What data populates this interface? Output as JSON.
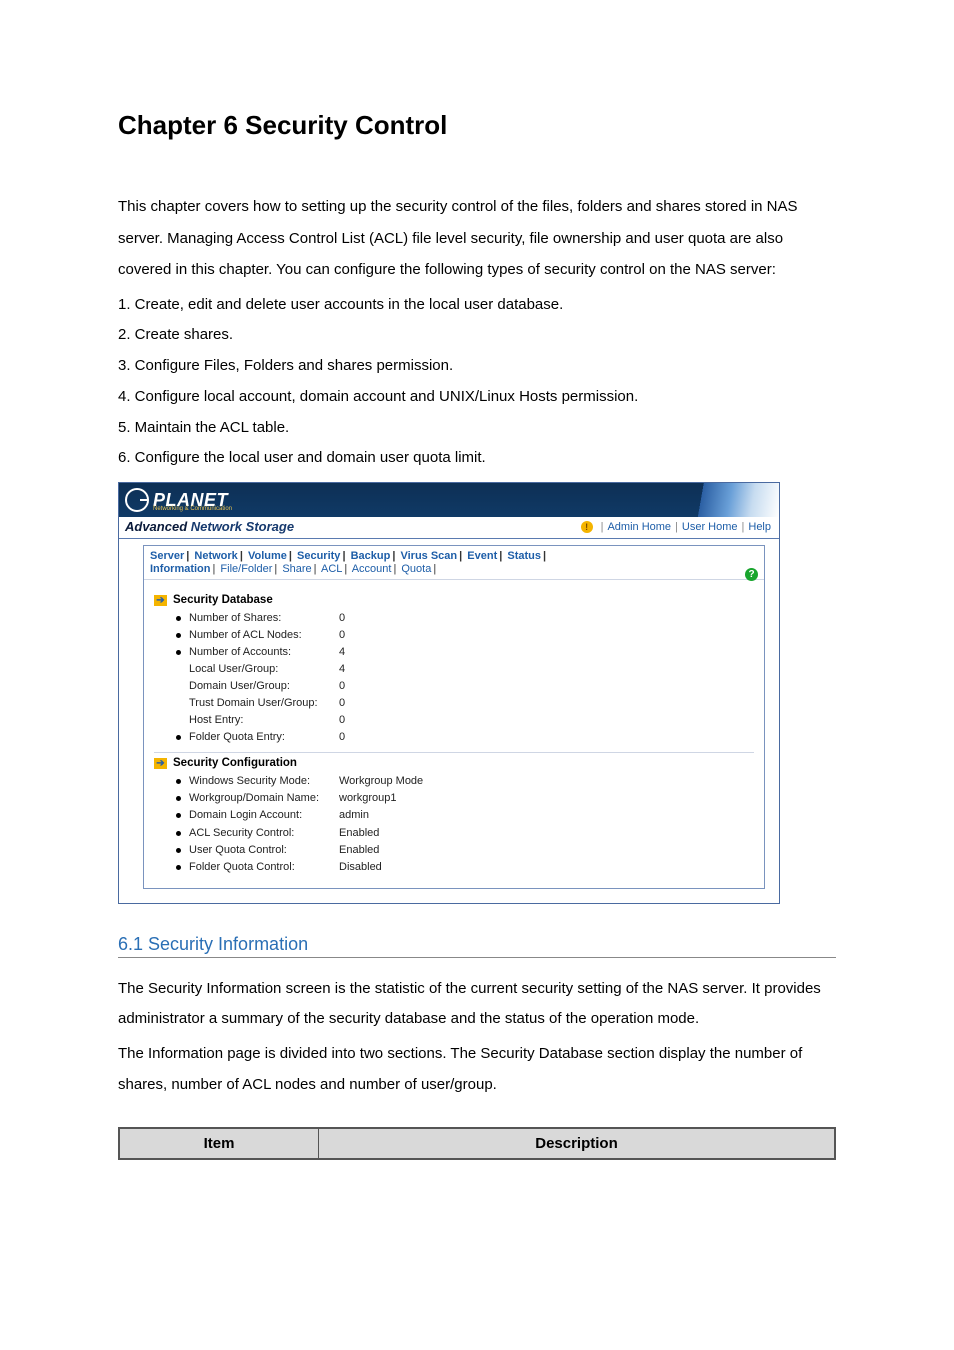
{
  "chapter_title": "Chapter 6 Security Control",
  "intro_paragraph": "This chapter covers how to setting up the security control of the files, folders and shares stored in NAS server. Managing Access Control List (ACL) file level security, file ownership and user quota are also covered in this chapter. You can configure the following types of security control on the NAS server:",
  "intro_items": [
    "1. Create, edit and delete user accounts in the local user database.",
    "2. Create shares.",
    "3. Configure Files, Folders and shares permission.",
    "4. Configure local account, domain account and UNIX/Linux Hosts permission.",
    "5. Maintain the ACL table.",
    "6. Configure the local user and domain user quota limit."
  ],
  "app": {
    "brand_text": "PLANET",
    "brand_sub": "Networking & Communication",
    "product_title_a": "Advanced ",
    "product_title_b": "Network Storage",
    "header_links": {
      "admin_home": "Admin Home",
      "user_home": "User Home",
      "help": "Help"
    },
    "main_tabs": [
      "Server",
      "Network",
      "Volume",
      "Security",
      "Backup",
      "Virus Scan",
      "Event",
      "Status"
    ],
    "sub_tabs": [
      "Information",
      "File/Folder",
      "Share",
      "ACL",
      "Account",
      "Quota"
    ],
    "sub_tab_active_index": 0,
    "sections": {
      "db": {
        "title": "Security Database",
        "rows": [
          {
            "bullet": true,
            "label": "Number of Shares:",
            "value": "0"
          },
          {
            "bullet": true,
            "label": "Number of ACL Nodes:",
            "value": "0"
          },
          {
            "bullet": true,
            "label": "Number of Accounts:",
            "value": "4"
          },
          {
            "bullet": false,
            "label": "Local User/Group:",
            "value": "4"
          },
          {
            "bullet": false,
            "label": "Domain User/Group:",
            "value": "0"
          },
          {
            "bullet": false,
            "label": "Trust Domain User/Group:",
            "value": "0"
          },
          {
            "bullet": false,
            "label": "Host Entry:",
            "value": "0"
          },
          {
            "bullet": true,
            "label": "Folder Quota Entry:",
            "value": "0"
          }
        ]
      },
      "cfg": {
        "title": "Security Configuration",
        "rows": [
          {
            "bullet": true,
            "label": "Windows Security Mode:",
            "value": "Workgroup Mode"
          },
          {
            "bullet": true,
            "label": "Workgroup/Domain Name:",
            "value": "workgroup1"
          },
          {
            "bullet": true,
            "label": "Domain Login Account:",
            "value": "admin"
          },
          {
            "bullet": true,
            "label": "ACL Security Control:",
            "value": "Enabled"
          },
          {
            "bullet": true,
            "label": "User Quota Control:",
            "value": "Enabled"
          },
          {
            "bullet": true,
            "label": "Folder Quota Control:",
            "value": "Disabled"
          }
        ]
      }
    }
  },
  "section_6_1": {
    "heading": "6.1 Security Information",
    "p1": "The Security Information screen is the statistic of the current security setting of the NAS server. It provides administrator a summary of the security database and the status of the operation mode.",
    "p2": "The Information page is divided into two sections. The Security Database section display the number of shares, number of ACL nodes and number of user/group."
  },
  "defs_table": {
    "col1": "Item",
    "col2": "Description"
  }
}
